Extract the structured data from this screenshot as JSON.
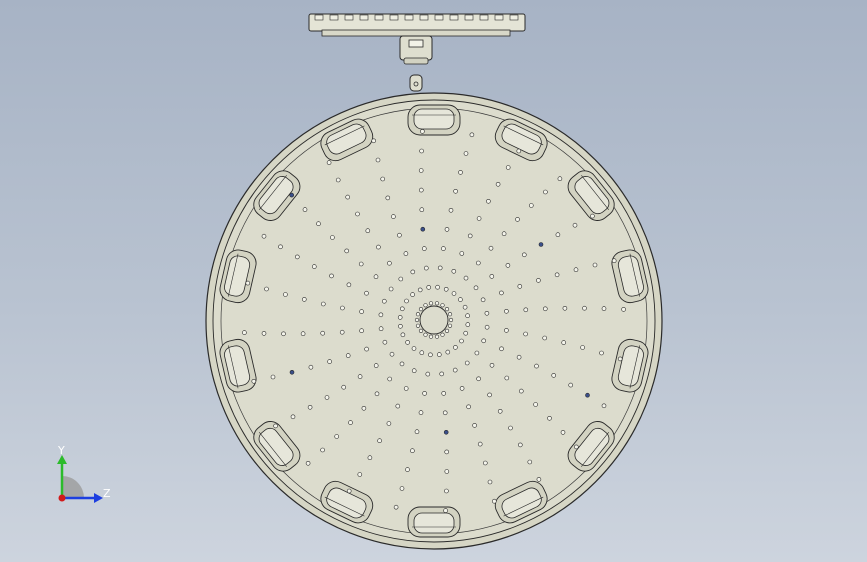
{
  "triad": {
    "y_label": "Y",
    "z_label": "Z",
    "colors": {
      "y": "#2bbb2b",
      "z": "#1d3fe0",
      "x": "#d11a1a"
    }
  },
  "part": {
    "body_fill": "#dcdccd",
    "edge_color": "#2a2a2a",
    "hole_count_per_spoke": 9,
    "spoke_count": 24,
    "pocket_count": 14,
    "highlight_hole_color": "#3a4f8a"
  }
}
